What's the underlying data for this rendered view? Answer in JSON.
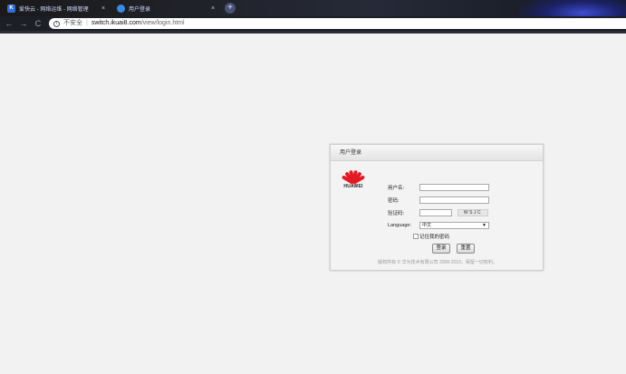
{
  "browser": {
    "tabs": [
      {
        "label": "爱快云 - 网络运维 - 网络管理",
        "icon": "ikuai-k-icon",
        "icon_text": "K"
      },
      {
        "label": "用户登录",
        "icon": "globe-icon"
      }
    ],
    "tab_close": "×",
    "new_tab": "+",
    "nav": {
      "back": "←",
      "forward": "→",
      "reload": "C"
    },
    "address": {
      "info_glyph": "i",
      "insecure": "不安全",
      "separator": "|",
      "host": "switch.ikuai8.com",
      "path": "/view/login.html"
    }
  },
  "login": {
    "title": "用户登录",
    "logo_text": "HUAWEI",
    "username_label": "用户名:",
    "username_value": "",
    "password_label": "密码:",
    "password_value": "",
    "captcha_label": "验证码:",
    "captcha_value": "",
    "captcha_text": "WSJC",
    "language_label": "Language:",
    "language_value": "中文",
    "select_arrow": "▼",
    "remember_label": "记住我的密码",
    "login_button": "登录",
    "reset_button": "重置",
    "copyright": "版权所有 © 华为技术有限公司 2008-2010，保留一切权利。"
  },
  "colors": {
    "brand_red": "#e21b23",
    "browser_dark": "#1d1f27",
    "page_bg": "#f2f2f2"
  }
}
